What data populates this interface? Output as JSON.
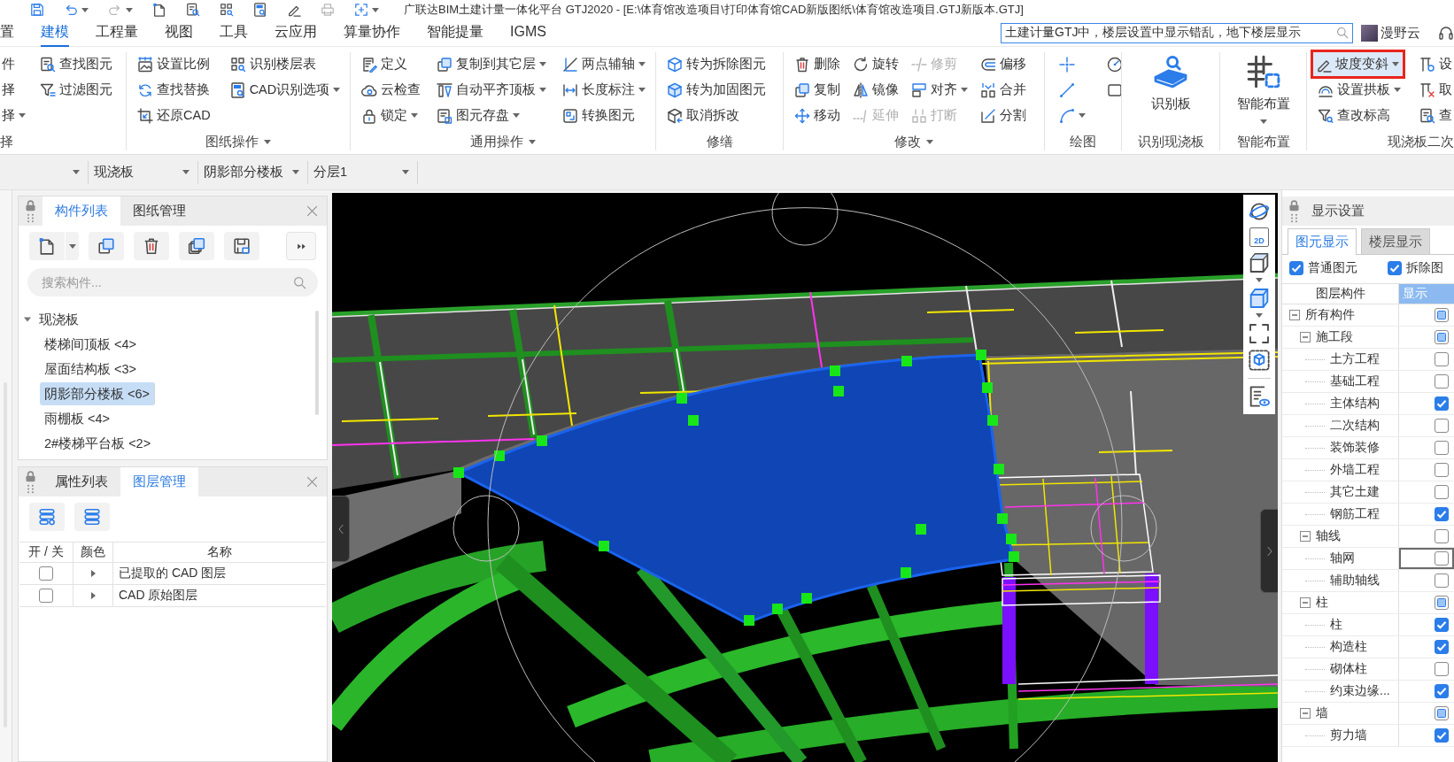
{
  "window": {
    "title": "广联达BIM土建计量一体化平台 GTJ2020 - [E:\\体育馆改造项目\\打印体育馆CAD新版图纸\\体育馆改造项目.GTJ新版本.GTJ]"
  },
  "menu": {
    "tabs": [
      {
        "label": "置",
        "selected": false
      },
      {
        "label": "建模",
        "selected": true
      },
      {
        "label": "工程量",
        "selected": false
      },
      {
        "label": "视图",
        "selected": false
      },
      {
        "label": "工具",
        "selected": false
      },
      {
        "label": "云应用",
        "selected": false
      },
      {
        "label": "算量协作",
        "selected": false
      },
      {
        "label": "智能提量",
        "selected": false
      },
      {
        "label": "IGMS",
        "selected": false
      }
    ],
    "search": {
      "value": "土建计量GTJ中，楼层设置中显示错乱，地下楼层显示"
    },
    "user": {
      "name": "漫野云"
    }
  },
  "ribbon": {
    "groups": [
      {
        "label": "择",
        "menu": false,
        "kind": "small",
        "columns": [
          [
            {
              "label": "件",
              "dropdown": false,
              "disabled": false,
              "highlighted": false
            },
            {
              "label": "择",
              "dropdown": false,
              "disabled": false,
              "highlighted": false
            },
            {
              "label": "择",
              "dropdown": true,
              "disabled": false,
              "highlighted": false
            }
          ],
          [
            {
              "label": "查找图元",
              "dropdown": false,
              "disabled": false,
              "highlighted": false
            },
            {
              "label": "过滤图元",
              "dropdown": false,
              "disabled": false,
              "highlighted": false
            }
          ]
        ]
      },
      {
        "label": "图纸操作",
        "menu": true,
        "kind": "small",
        "columns": [
          [
            {
              "label": "设置比例",
              "dropdown": false,
              "disabled": false,
              "highlighted": false
            },
            {
              "label": "查找替换",
              "dropdown": false,
              "disabled": false,
              "highlighted": false
            },
            {
              "label": "还原CAD",
              "dropdown": false,
              "disabled": false,
              "highlighted": false
            }
          ],
          [
            {
              "label": "识别楼层表",
              "dropdown": false,
              "disabled": false,
              "highlighted": false
            },
            {
              "label": "CAD识别选项",
              "dropdown": true,
              "disabled": false,
              "highlighted": false
            }
          ]
        ]
      },
      {
        "label": "通用操作",
        "menu": true,
        "kind": "small",
        "columns": [
          [
            {
              "label": "定义",
              "dropdown": false,
              "disabled": false,
              "highlighted": false
            },
            {
              "label": "云检查",
              "dropdown": false,
              "disabled": false,
              "highlighted": false
            },
            {
              "label": "锁定",
              "dropdown": true,
              "disabled": false,
              "highlighted": false
            }
          ],
          [
            {
              "label": "复制到其它层",
              "dropdown": true,
              "disabled": false,
              "highlighted": false
            },
            {
              "label": "自动平齐顶板",
              "dropdown": true,
              "disabled": false,
              "highlighted": false
            },
            {
              "label": "图元存盘",
              "dropdown": true,
              "disabled": false,
              "highlighted": false
            }
          ],
          [
            {
              "label": "两点辅轴",
              "dropdown": true,
              "disabled": false,
              "highlighted": false
            },
            {
              "label": "长度标注",
              "dropdown": true,
              "disabled": false,
              "highlighted": false
            },
            {
              "label": "转换图元",
              "dropdown": false,
              "disabled": false,
              "highlighted": false
            }
          ]
        ]
      },
      {
        "label": "修缮",
        "menu": false,
        "kind": "small",
        "columns": [
          [
            {
              "label": "转为拆除图元",
              "dropdown": false,
              "disabled": false,
              "highlighted": false
            },
            {
              "label": "转为加固图元",
              "dropdown": false,
              "disabled": false,
              "highlighted": false
            },
            {
              "label": "取消拆改",
              "dropdown": false,
              "disabled": false,
              "highlighted": false
            }
          ]
        ]
      },
      {
        "label": "修改",
        "menu": true,
        "kind": "small",
        "columns": [
          [
            {
              "label": "删除",
              "dropdown": false,
              "disabled": false,
              "highlighted": false
            },
            {
              "label": "复制",
              "dropdown": false,
              "disabled": false,
              "highlighted": false
            },
            {
              "label": "移动",
              "dropdown": false,
              "disabled": false,
              "highlighted": false
            }
          ],
          [
            {
              "label": "旋转",
              "dropdown": false,
              "disabled": false,
              "highlighted": false
            },
            {
              "label": "镜像",
              "dropdown": false,
              "disabled": false,
              "highlighted": false
            },
            {
              "label": "延伸",
              "dropdown": false,
              "disabled": true,
              "highlighted": false
            }
          ],
          [
            {
              "label": "修剪",
              "dropdown": false,
              "disabled": true,
              "highlighted": false
            },
            {
              "label": "对齐",
              "dropdown": true,
              "disabled": false,
              "highlighted": false
            },
            {
              "label": "打断",
              "dropdown": false,
              "disabled": true,
              "highlighted": false
            }
          ],
          [
            {
              "label": "偏移",
              "dropdown": false,
              "disabled": false,
              "highlighted": false
            },
            {
              "label": "合并",
              "dropdown": false,
              "disabled": false,
              "highlighted": false
            },
            {
              "label": "分割",
              "dropdown": false,
              "disabled": false,
              "highlighted": false
            }
          ]
        ]
      },
      {
        "label": "绘图",
        "menu": false,
        "kind": "icons",
        "columns": [
          [
            {
              "dropdown": false,
              "disabled": false,
              "highlighted": false
            },
            {
              "dropdown": false,
              "disabled": false,
              "highlighted": false
            },
            {
              "dropdown": true,
              "disabled": false,
              "highlighted": false
            }
          ],
          [
            {
              "dropdown": false,
              "disabled": false,
              "highlighted": false
            },
            {
              "dropdown": false,
              "disabled": false,
              "highlighted": false
            }
          ]
        ]
      },
      {
        "label": "识别现浇板",
        "menu": false,
        "kind": "large",
        "columns": [
          [
            {
              "label": "识别板",
              "dropdown": false,
              "disabled": false,
              "highlighted": false
            }
          ]
        ]
      },
      {
        "label": "智能布置",
        "menu": false,
        "kind": "large",
        "columns": [
          [
            {
              "label": "智能布置",
              "dropdown": true,
              "disabled": false,
              "highlighted": false
            }
          ]
        ]
      },
      {
        "label": "现浇板二次",
        "menu": false,
        "kind": "small",
        "columns": [
          [
            {
              "label": "坡度变斜",
              "dropdown": true,
              "disabled": false,
              "highlighted": true
            },
            {
              "label": "设置拱板",
              "dropdown": true,
              "disabled": false,
              "highlighted": false
            },
            {
              "label": "查改标高",
              "dropdown": false,
              "disabled": false,
              "highlighted": false
            }
          ],
          [
            {
              "label": "设",
              "dropdown": false,
              "disabled": false,
              "highlighted": false
            },
            {
              "label": "取",
              "dropdown": false,
              "disabled": false,
              "highlighted": false
            },
            {
              "label": "查",
              "dropdown": false,
              "disabled": false,
              "highlighted": false
            }
          ]
        ]
      }
    ]
  },
  "selectors": [
    {
      "kind": "blank"
    },
    {
      "kind": "text",
      "value": "现浇板"
    },
    {
      "kind": "text",
      "value": "阴影部分楼板"
    },
    {
      "kind": "text",
      "value": "分层1"
    }
  ],
  "component_panel": {
    "tabs": [
      {
        "label": "构件列表",
        "selected": true
      },
      {
        "label": "图纸管理",
        "selected": false
      }
    ],
    "search": {
      "placeholder": "搜索构件..."
    },
    "tree": [
      {
        "label": "现浇板",
        "expanded": true,
        "selected": false,
        "children": [
          {
            "label": "楼梯间顶板 <4>",
            "selected": false
          },
          {
            "label": "屋面结构板 <3>",
            "selected": false
          },
          {
            "label": "阴影部分楼板 <6>",
            "selected": true
          },
          {
            "label": "雨棚板 <4>",
            "selected": false
          },
          {
            "label": "2#楼梯平台板 <2>",
            "selected": false
          }
        ]
      }
    ]
  },
  "layer_panel": {
    "tabs": [
      {
        "label": "属性列表",
        "selected": false
      },
      {
        "label": "图层管理",
        "selected": true
      }
    ],
    "columns": [
      "开 / 关",
      "颜色",
      "名称"
    ],
    "rows": [
      {
        "checked": false,
        "expanded": false,
        "name": "已提取的 CAD 图层"
      },
      {
        "checked": false,
        "expanded": false,
        "name": "CAD 原始图层"
      }
    ]
  },
  "viewport": {
    "toolbar": {
      "view_2d": "2D"
    }
  },
  "display_panel": {
    "title": "显示设置",
    "tabs": [
      {
        "label": "图元显示",
        "selected": true
      },
      {
        "label": "楼层显示",
        "selected": false
      }
    ],
    "filters": [
      {
        "label": "普通图元",
        "checked": true
      },
      {
        "label": "拆除图",
        "checked": true
      }
    ],
    "columns": [
      "图层构件",
      "显示"
    ],
    "tree": [
      {
        "label": "所有构件",
        "expanded": true,
        "checked": false,
        "mixed": true,
        "children": [
          {
            "label": "施工段",
            "expanded": true,
            "checked": false,
            "mixed": true,
            "children": [
              {
                "label": "土方工程",
                "checked": false,
                "mixed": false
              },
              {
                "label": "基础工程",
                "checked": false,
                "mixed": false
              },
              {
                "label": "主体结构",
                "checked": true,
                "mixed": false
              },
              {
                "label": "二次结构",
                "checked": false,
                "mixed": false
              },
              {
                "label": "装饰装修",
                "checked": false,
                "mixed": false
              },
              {
                "label": "外墙工程",
                "checked": false,
                "mixed": false
              },
              {
                "label": "其它土建",
                "checked": false,
                "mixed": false
              },
              {
                "label": "钢筋工程",
                "checked": true,
                "mixed": false
              }
            ]
          },
          {
            "label": "轴线",
            "expanded": true,
            "checked": false,
            "mixed": false,
            "children": [
              {
                "label": "轴网",
                "checked": false,
                "mixed": false,
                "focused": true
              },
              {
                "label": "辅助轴线",
                "checked": false,
                "mixed": false,
                "focused": false
              }
            ]
          },
          {
            "label": "柱",
            "expanded": true,
            "checked": false,
            "mixed": true,
            "children": [
              {
                "label": "柱",
                "checked": true,
                "mixed": false
              },
              {
                "label": "构造柱",
                "checked": true,
                "mixed": false
              },
              {
                "label": "砌体柱",
                "checked": false,
                "mixed": false
              },
              {
                "label": "约束边缘...",
                "checked": true,
                "mixed": false
              }
            ]
          },
          {
            "label": "墙",
            "expanded": true,
            "checked": false,
            "mixed": true,
            "children": [
              {
                "label": "剪力墙",
                "checked": true,
                "mixed": false
              }
            ]
          }
        ]
      }
    ]
  }
}
